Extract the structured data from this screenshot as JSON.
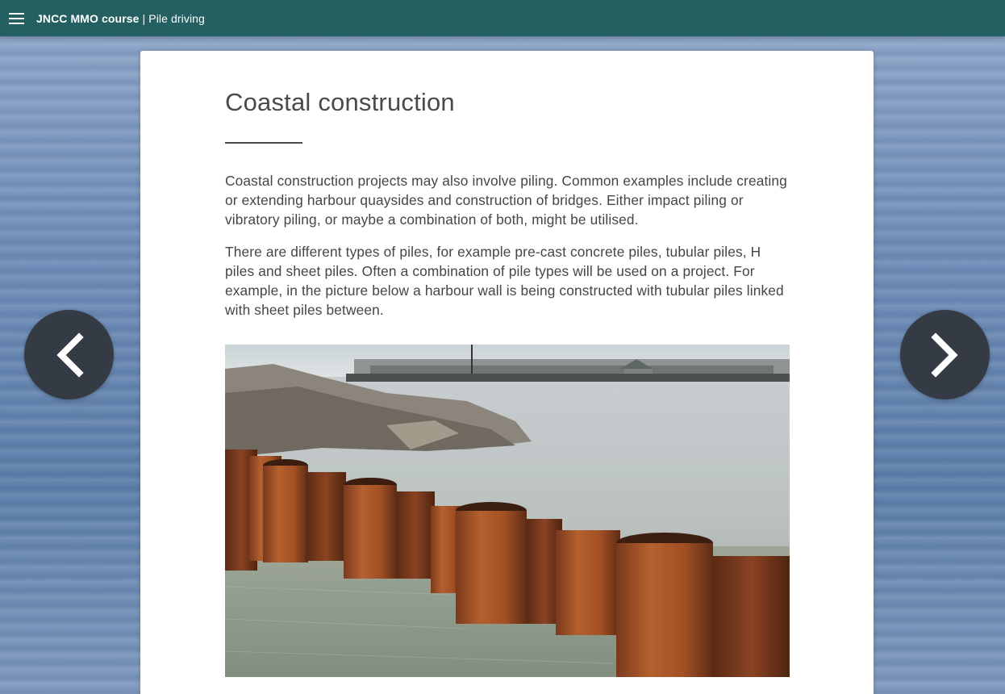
{
  "header": {
    "course_name": "JNCC MMO course",
    "separator": " | ",
    "section_name": "Pile driving",
    "menu_icon": "hamburger-menu-icon"
  },
  "page": {
    "title": "Coastal construction",
    "paragraphs": [
      "Coastal construction projects may also involve piling. Common examples include creating or extending harbour quaysides and construction of bridges. Either impact piling or vibratory piling, or maybe a combination of both, might be utilised.",
      "There are different types of piles, for example pre-cast concrete piles, tubular piles, H piles and sheet piles. Often a combination of pile types will be used on a project. For example, in the picture below a harbour wall is being constructed with tubular piles linked with sheet piles between."
    ]
  },
  "navigation": {
    "prev_icon": "chevron-left-icon",
    "next_icon": "chevron-right-icon"
  },
  "colors": {
    "header_bg": "#245f62",
    "nav_button_bg": "#353b44",
    "text": "#454545"
  }
}
